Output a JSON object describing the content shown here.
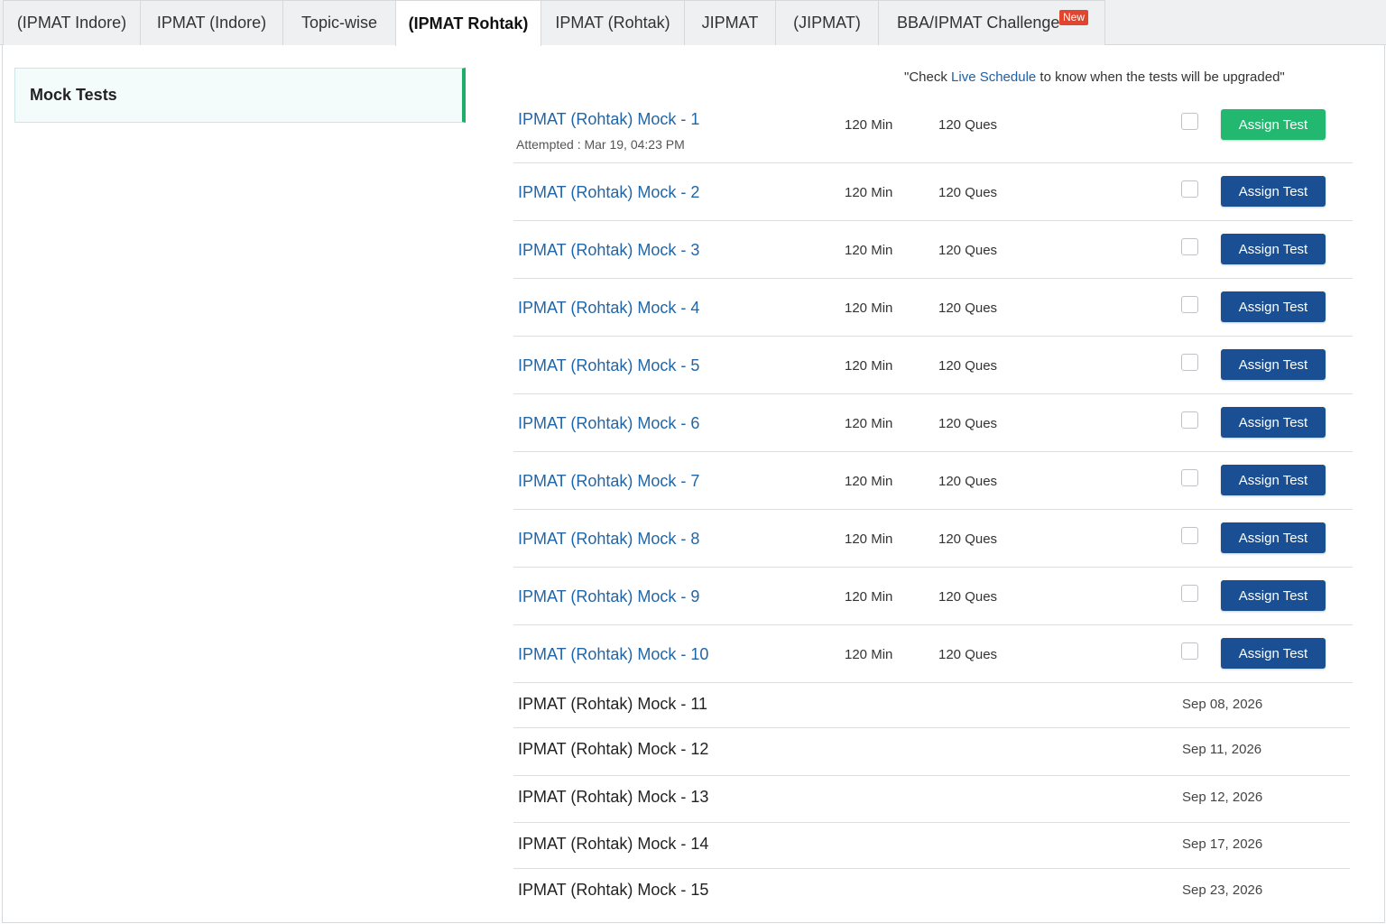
{
  "tabs": [
    {
      "label": "(IPMAT Indore)",
      "active": false
    },
    {
      "label": "IPMAT (Indore)",
      "active": false
    },
    {
      "label": "Topic-wise",
      "active": false
    },
    {
      "label": "(IPMAT Rohtak)",
      "active": true
    },
    {
      "label": "IPMAT (Rohtak)",
      "active": false
    },
    {
      "label": "JIPMAT",
      "active": false
    },
    {
      "label": "(JIPMAT)",
      "active": false
    },
    {
      "label": "BBA/IPMAT Challenge",
      "active": false,
      "badge": "New"
    }
  ],
  "sidebar": {
    "item_label": "Mock Tests"
  },
  "notice": {
    "prefix": "\"Check ",
    "link": "Live Schedule",
    "suffix": " to know when the tests will be upgraded\""
  },
  "mocks": [
    {
      "title": "IPMAT (Rohtak) Mock - 1",
      "duration": "120 Min",
      "questions": "120 Ques",
      "button": "Assign Test",
      "attempted": "Attempted : Mar 19, 04:23 PM"
    },
    {
      "title": "IPMAT (Rohtak) Mock - 2",
      "duration": "120 Min",
      "questions": "120 Ques",
      "button": "Assign Test"
    },
    {
      "title": "IPMAT (Rohtak) Mock - 3",
      "duration": "120 Min",
      "questions": "120 Ques",
      "button": "Assign Test"
    },
    {
      "title": "IPMAT (Rohtak) Mock - 4",
      "duration": "120 Min",
      "questions": "120 Ques",
      "button": "Assign Test"
    },
    {
      "title": "IPMAT (Rohtak) Mock - 5",
      "duration": "120 Min",
      "questions": "120 Ques",
      "button": "Assign Test"
    },
    {
      "title": "IPMAT (Rohtak) Mock - 6",
      "duration": "120 Min",
      "questions": "120 Ques",
      "button": "Assign Test"
    },
    {
      "title": "IPMAT (Rohtak) Mock - 7",
      "duration": "120 Min",
      "questions": "120 Ques",
      "button": "Assign Test"
    },
    {
      "title": "IPMAT (Rohtak) Mock - 8",
      "duration": "120 Min",
      "questions": "120 Ques",
      "button": "Assign Test"
    },
    {
      "title": "IPMAT (Rohtak) Mock - 9",
      "duration": "120 Min",
      "questions": "120 Ques",
      "button": "Assign Test"
    },
    {
      "title": "IPMAT (Rohtak) Mock - 10",
      "duration": "120 Min",
      "questions": "120 Ques",
      "button": "Assign Test"
    }
  ],
  "upcoming": [
    {
      "title": "IPMAT (Rohtak) Mock - 11",
      "date": "Sep 08, 2026"
    },
    {
      "title": "IPMAT (Rohtak) Mock - 12",
      "date": "Sep 11, 2026"
    },
    {
      "title": "IPMAT (Rohtak) Mock - 13",
      "date": "Sep 12, 2026"
    },
    {
      "title": "IPMAT (Rohtak) Mock - 14",
      "date": "Sep 17, 2026"
    },
    {
      "title": "IPMAT (Rohtak) Mock - 15",
      "date": "Sep 23, 2026"
    }
  ],
  "colors": {
    "link": "#1f65a8",
    "assign_button": "#1a4f94",
    "assign_button_attempted": "#23b86f",
    "sidebar_accent": "#1fae6a",
    "new_badge": "#e2452f"
  }
}
